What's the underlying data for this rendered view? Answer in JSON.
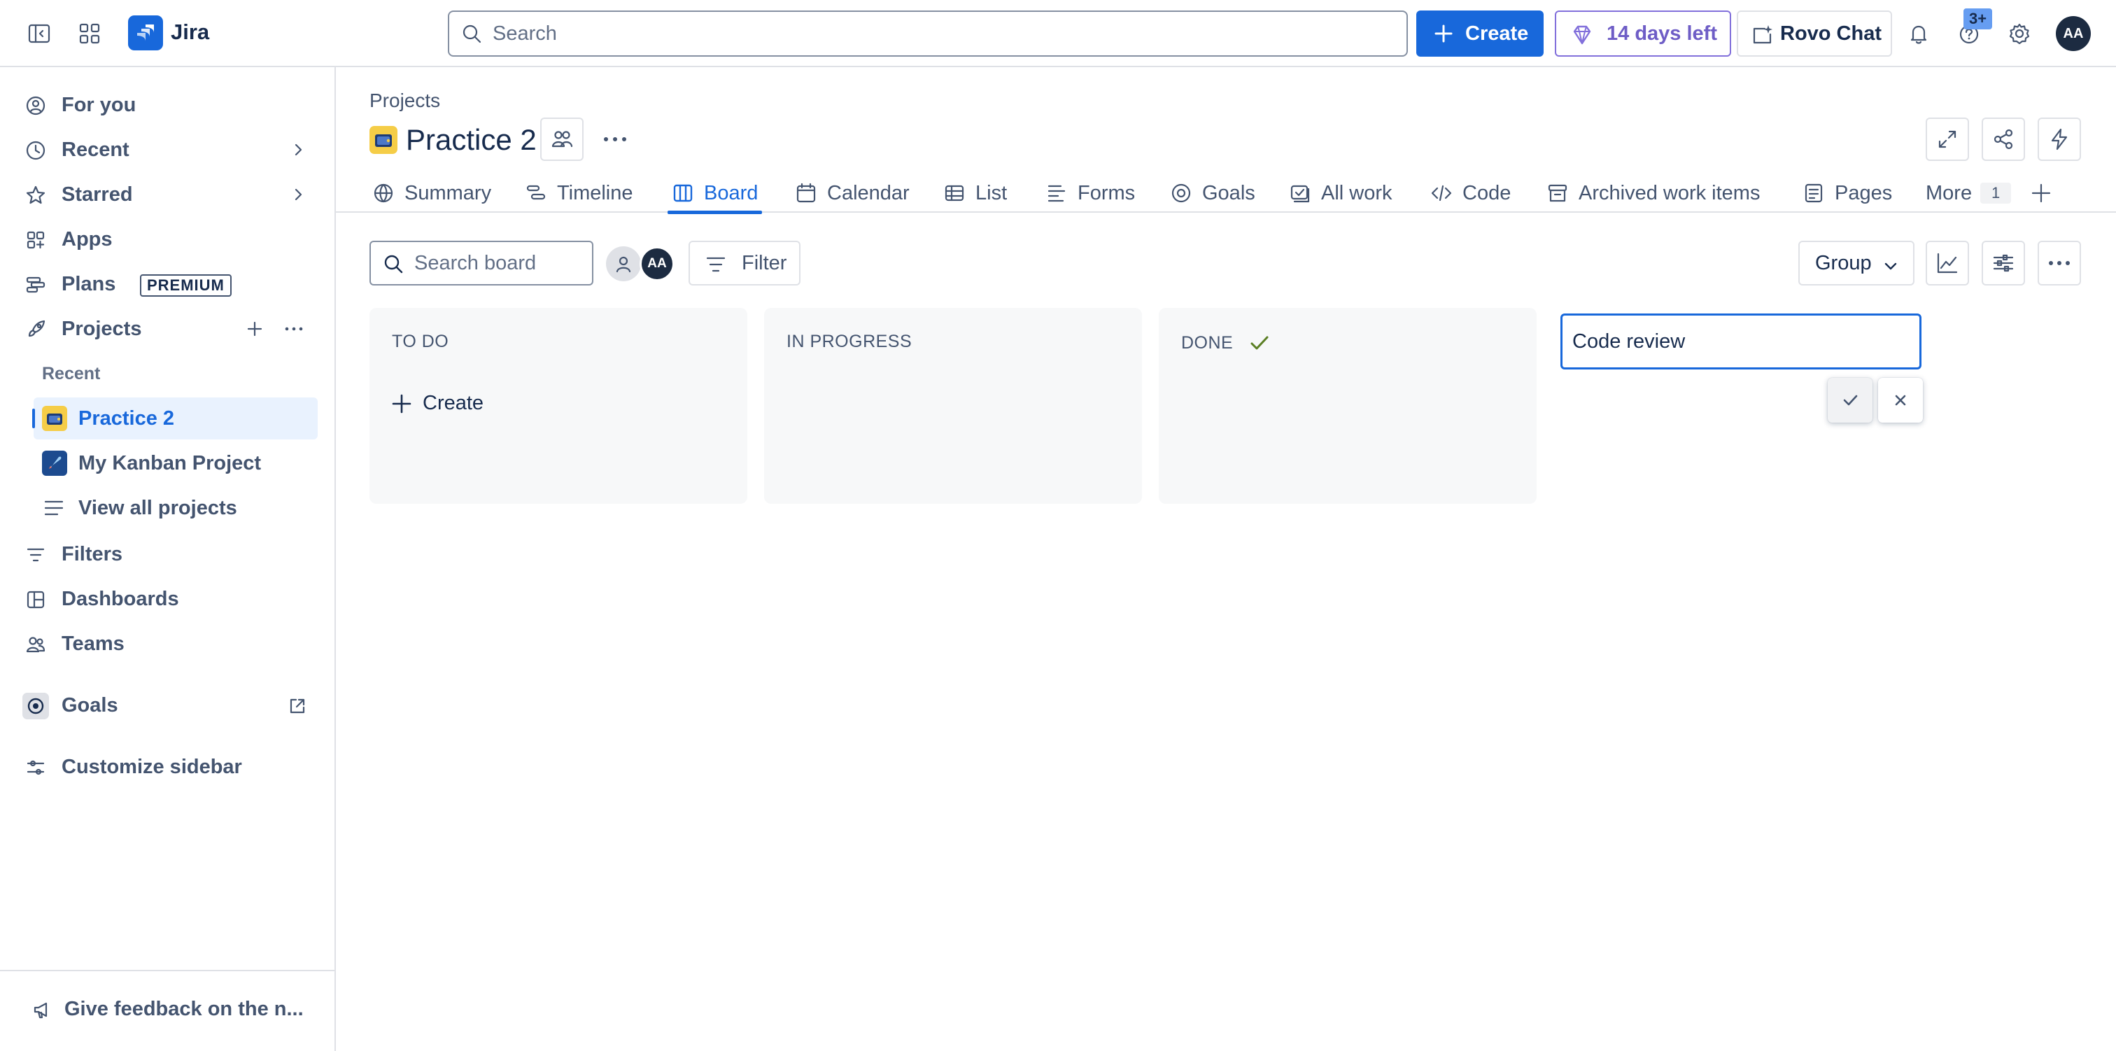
{
  "app": {
    "name": "Jira"
  },
  "topbar": {
    "search_placeholder": "Search",
    "create_label": "Create",
    "trial_label": "14 days left",
    "rovo_label": "Rovo Chat",
    "notif_badge": "3+",
    "avatar_initials": "AA"
  },
  "sidebar": {
    "items": [
      {
        "label": "For you"
      },
      {
        "label": "Recent"
      },
      {
        "label": "Starred"
      },
      {
        "label": "Apps"
      },
      {
        "label": "Plans",
        "badge": "PREMIUM"
      },
      {
        "label": "Projects"
      }
    ],
    "recent_heading": "Recent",
    "projects": [
      {
        "label": "Practice 2",
        "active": true
      },
      {
        "label": "My Kanban Project"
      },
      {
        "label": "View all projects"
      }
    ],
    "lower_items": [
      {
        "label": "Filters"
      },
      {
        "label": "Dashboards"
      },
      {
        "label": "Teams"
      },
      {
        "label": "Goals"
      },
      {
        "label": "Customize sidebar"
      }
    ],
    "feedback_label": "Give feedback on the n..."
  },
  "project": {
    "breadcrumb": "Projects",
    "title": "Practice 2"
  },
  "tabs": [
    {
      "label": "Summary"
    },
    {
      "label": "Timeline"
    },
    {
      "label": "Board",
      "active": true
    },
    {
      "label": "Calendar"
    },
    {
      "label": "List"
    },
    {
      "label": "Forms"
    },
    {
      "label": "Goals"
    },
    {
      "label": "All work"
    },
    {
      "label": "Code"
    },
    {
      "label": "Archived work items"
    },
    {
      "label": "Pages"
    },
    {
      "label": "More",
      "count": "1"
    }
  ],
  "board": {
    "search_placeholder": "Search board",
    "filter_label": "Filter",
    "group_label": "Group",
    "avatar_initials": "AA",
    "columns": [
      {
        "title": "TO DO",
        "create_label": "Create"
      },
      {
        "title": "IN PROGRESS"
      },
      {
        "title": "DONE",
        "done": true
      }
    ],
    "new_column_value": "Code review"
  },
  "colors": {
    "accent": "#1868db",
    "trial": "#6e5dc6",
    "done_check": "#5b7f24",
    "column_bg": "#f7f8f9"
  }
}
